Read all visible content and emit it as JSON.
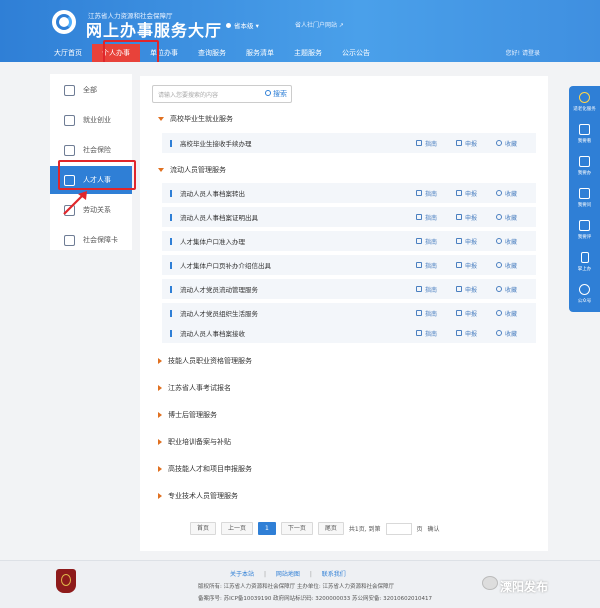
{
  "header": {
    "org": "江苏省人力资源和社会保障厅",
    "title": "网上办事服务大厅",
    "region": "省本级",
    "portal": "省人社门户网站",
    "login": "您好! 请登录",
    "nav": [
      "大厅首页",
      "个人办事",
      "单位办事",
      "查询服务",
      "服务清单",
      "主题服务",
      "公示公告"
    ]
  },
  "sidebar": {
    "items": [
      {
        "label": "全部",
        "icon": "grid-icon"
      },
      {
        "label": "就业创业",
        "icon": "briefcase-icon"
      },
      {
        "label": "社会保险",
        "icon": "umbrella-icon"
      },
      {
        "label": "人才人事",
        "icon": "people-icon",
        "active": true
      },
      {
        "label": "劳动关系",
        "icon": "handshake-icon"
      },
      {
        "label": "社会保障卡",
        "icon": "card-icon"
      }
    ]
  },
  "search": {
    "placeholder": "请输入您要搜索的内容",
    "button": "搜索"
  },
  "categories": [
    {
      "label": "高校毕业生就业服务",
      "expanded": true,
      "items": [
        "高校毕业生接收手续办理"
      ]
    },
    {
      "label": "流动人员管理服务",
      "expanded": true,
      "items": [
        "流动人员人事档案转出",
        "流动人员人事档案证明出具",
        "人才集体户口准入办理",
        "人才集体户口页补办介绍信出具",
        "流动人才党员流动管理服务",
        "流动人才党员组织生活服务",
        "流动人员人事档案接收"
      ]
    },
    {
      "label": "技能人员职业资格管理服务",
      "expanded": false
    },
    {
      "label": "江苏省人事考试报名",
      "expanded": false
    },
    {
      "label": "博士后管理服务",
      "expanded": false
    },
    {
      "label": "职业培训备案与补贴",
      "expanded": false
    },
    {
      "label": "高技能人才和项目申报服务",
      "expanded": false
    },
    {
      "label": "专业技术人员管理服务",
      "expanded": false
    }
  ],
  "row_actions": {
    "guide": "指南",
    "apply": "申报",
    "favorite": "收藏"
  },
  "pager": {
    "first": "首页",
    "prev": "上一页",
    "current": "1",
    "next": "下一页",
    "last": "尾页",
    "info": "共1页, 到第",
    "unit": "页",
    "confirm": "确认"
  },
  "right_bar": [
    "适老化服务",
    "我要看",
    "我要办",
    "我要问",
    "我要评",
    "掌上办",
    "公众号"
  ],
  "footer": {
    "links": [
      "关于本站",
      "网站地图",
      "联系我们"
    ],
    "line1": "版权所有: 江苏省人力资源和社会保障厅    主办单位: 江苏省人力资源和社会保障厅",
    "line2": "备案序号: 苏ICP备10039190    政府网站标识码: 3200000033    苏公网安备: 32010602010417",
    "watermark": "溧阳发布"
  },
  "colors": {
    "primary": "#2f7fd6",
    "highlight": "#e0262b",
    "accent": "#e07020"
  }
}
